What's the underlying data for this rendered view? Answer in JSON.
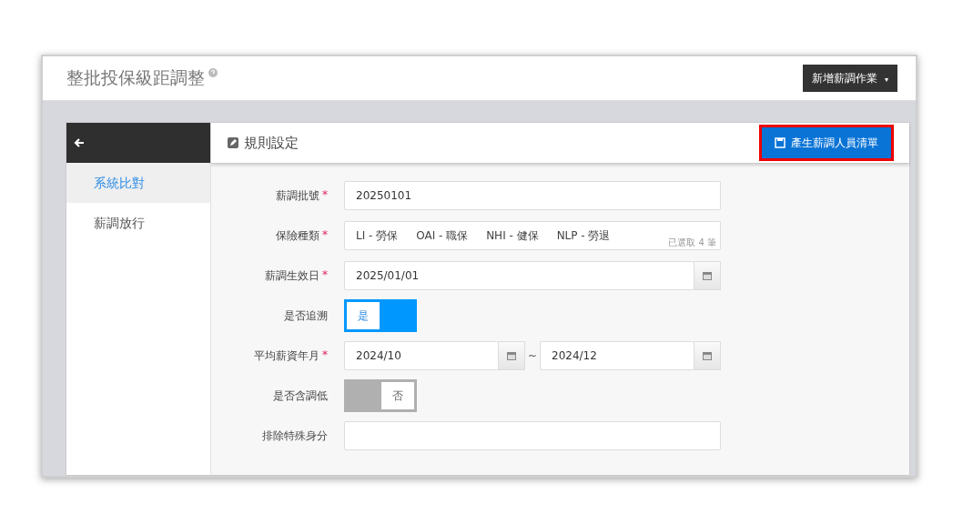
{
  "page": {
    "title": "整批投保級距調整",
    "menu_button": "新增薪調作業",
    "menu_caret": "▾"
  },
  "sidebar": {
    "items": [
      {
        "label": "系統比對",
        "selected": true
      },
      {
        "label": "薪調放行",
        "selected": false
      }
    ]
  },
  "section": {
    "title": "規則設定",
    "action_button": "產生薪調人員清單"
  },
  "form": [
    {
      "kind": "text",
      "label": "薪調批號",
      "required_mark": "*",
      "value": "20250101"
    },
    {
      "kind": "tags",
      "label": "保險種類",
      "required_mark": "*",
      "tags": [
        "LI - 勞保",
        "OAI - 職保",
        "NHI - 健保",
        "NLP - 勞退"
      ],
      "count": "已選取 4 筆"
    },
    {
      "kind": "date",
      "label": "薪調生效日",
      "required_mark": "*",
      "value": "2025/01/01"
    },
    {
      "kind": "toggle",
      "label": "是否追溯",
      "on": true,
      "text": "是"
    },
    {
      "kind": "range",
      "label": "平均薪資年月",
      "required_mark": "*",
      "from": "2024/10",
      "separator": "~",
      "to": "2024/12"
    },
    {
      "kind": "toggle",
      "label": "是否含調低",
      "on": false,
      "text": "否"
    },
    {
      "kind": "text",
      "label": "排除特殊身分"
    }
  ]
}
